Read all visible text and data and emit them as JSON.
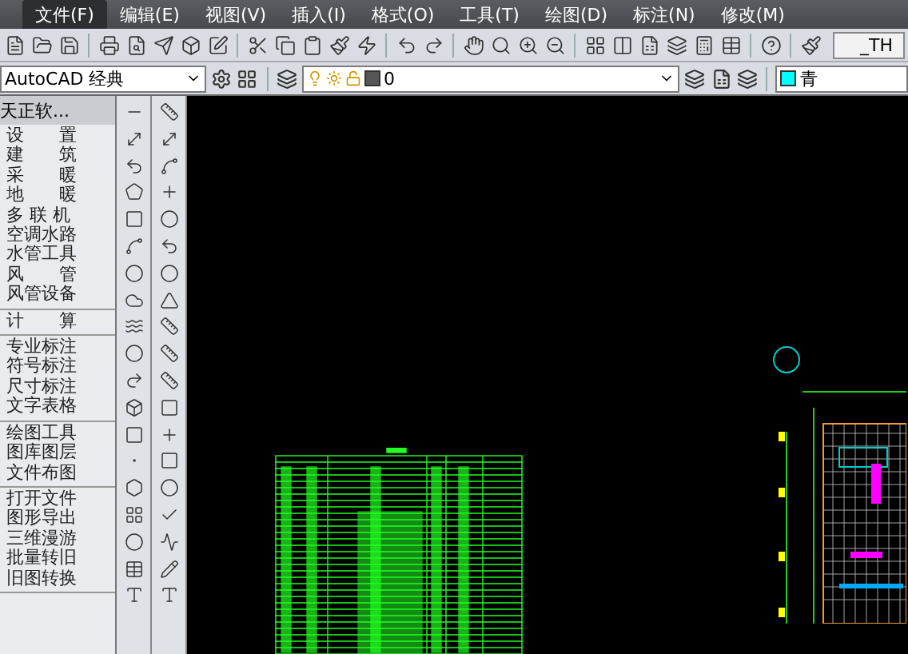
{
  "menu_bar": {
    "items": [
      {
        "label": "文件(F)",
        "selected": true
      },
      {
        "label": "编辑(E)",
        "selected": false
      },
      {
        "label": "视图(V)",
        "selected": false
      },
      {
        "label": "插入(I)",
        "selected": false
      },
      {
        "label": "格式(O)",
        "selected": false
      },
      {
        "label": "工具(T)",
        "selected": false
      },
      {
        "label": "绘图(D)",
        "selected": false
      },
      {
        "label": "标注(N)",
        "selected": false
      },
      {
        "label": "修改(M)",
        "selected": false
      }
    ]
  },
  "toolbar": {
    "style_field": "_TH"
  },
  "layer_bar": {
    "workspace": "AutoCAD 经典",
    "layer": "0",
    "color": {
      "label": "青",
      "color": "#00ffff"
    }
  },
  "sidebar": {
    "title": "天正软...",
    "groups": [
      [
        "设　　置",
        "建　　筑",
        "采　　暖",
        "地　　暖",
        "多 联 机",
        "空调水路",
        "水管工具",
        "风　　管",
        "风管设备"
      ],
      [
        "计　　算"
      ],
      [
        "专业标注",
        "符号标注",
        "尺寸标注",
        "文字表格"
      ],
      [
        "绘图工具",
        "图库图层",
        "文件布图"
      ],
      [
        "打开文件",
        "图形导出",
        "三维漫游",
        "批量转旧",
        "旧图转换"
      ]
    ]
  }
}
